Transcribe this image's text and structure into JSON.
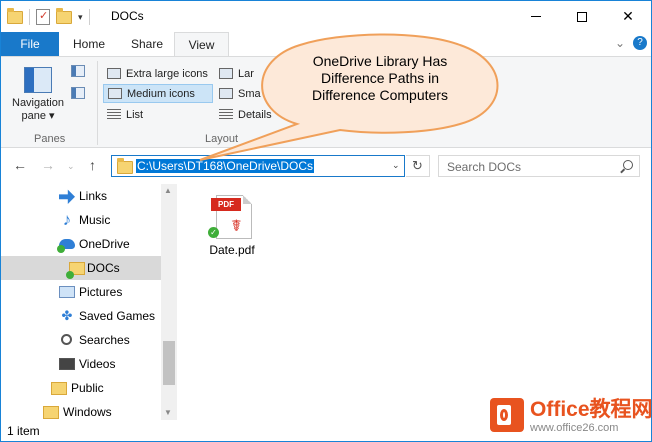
{
  "window": {
    "title": "DOCs",
    "controls": {
      "minimize": "–",
      "maximize": "□",
      "close": "✕"
    }
  },
  "ribbon": {
    "tabs": [
      "File",
      "Home",
      "Share",
      "View"
    ],
    "active_tab": "View",
    "panes_group": {
      "navigation_pane_label_1": "Navigation",
      "navigation_pane_label_2": "pane",
      "group_label": "Panes"
    },
    "layout_group": {
      "items": [
        "Extra large icons",
        "Medium icons",
        "List",
        "Lar",
        "Sma",
        "Details"
      ],
      "selected": "Medium icons",
      "group_label": "Layout"
    }
  },
  "address_bar": {
    "path": "C:\\Users\\DT168\\OneDrive\\DOCs",
    "search_placeholder": "Search DOCs"
  },
  "sidebar": {
    "items": [
      {
        "label": "Links",
        "icon": "links-icon"
      },
      {
        "label": "Music",
        "icon": "music-icon"
      },
      {
        "label": "OneDrive",
        "icon": "onedrive-icon"
      },
      {
        "label": "DOCs",
        "icon": "folder-synced-icon",
        "selected": true
      },
      {
        "label": "Pictures",
        "icon": "pictures-icon"
      },
      {
        "label": "Saved Games",
        "icon": "saved-games-icon"
      },
      {
        "label": "Searches",
        "icon": "searches-icon"
      },
      {
        "label": "Videos",
        "icon": "videos-icon"
      },
      {
        "label": "Public",
        "icon": "folder-icon"
      },
      {
        "label": "Windows",
        "icon": "folder-icon"
      }
    ]
  },
  "content": {
    "files": [
      {
        "name": "Date.pdf",
        "badge": "PDF",
        "icon": "pdf-file-icon",
        "sync_status": "synced"
      }
    ]
  },
  "status_bar": {
    "item_count": "1 item"
  },
  "callout": {
    "lines": [
      "OneDrive Library Has",
      "Difference Paths in",
      "Difference Computers"
    ]
  },
  "watermark": {
    "title": "Office教程网",
    "url": "www.office26.com"
  },
  "colors": {
    "accent": "#1979ca",
    "callout_fill": "#fde9d9",
    "callout_border": "#f0a05a",
    "watermark": "#e8531f",
    "pdf_red": "#d62a1e",
    "sync_green": "#3fae39"
  }
}
